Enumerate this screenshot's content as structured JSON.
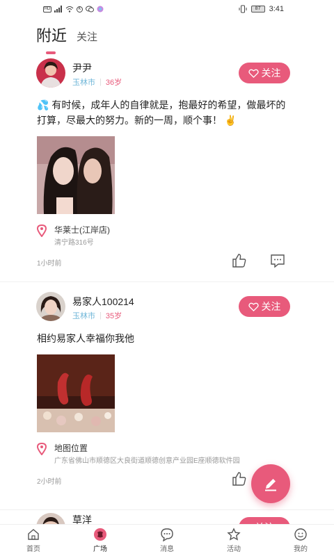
{
  "status_bar": {
    "left_icons": [
      "hd-icon",
      "signal-icon",
      "wifi-icon",
      "k-app-icon",
      "wechat-icon",
      "app-icon"
    ],
    "battery": "87",
    "time": "3:41"
  },
  "tabs": [
    {
      "label": "附近",
      "active": true
    },
    {
      "label": "关注",
      "active": false
    }
  ],
  "accent_color": "#e85a7b",
  "posts": [
    {
      "name": "尹尹",
      "city": "玉林市",
      "age": "36岁",
      "follow_label": "关注",
      "content": "💦 有时候，成年人的自律就是，抱最好的希望，做最坏的打算，尽最大的努力。新的一周，顺个事！ ✌️",
      "location_name": "华莱士(江岸店)",
      "location_addr": "清宁路316号",
      "time": "1小时前"
    },
    {
      "name": "易家人100214",
      "city": "玉林市",
      "age": "35岁",
      "follow_label": "关注",
      "content": "相约易家人幸福你我他",
      "location_name": "地图位置",
      "location_addr": "广东省佛山市顺德区大良街道顺德创意产业园E座顺德软件园",
      "time": "2小时前"
    },
    {
      "name": "草洋",
      "follow_label": "关注"
    }
  ],
  "bottom_nav": [
    {
      "label": "首页",
      "icon": "home-icon"
    },
    {
      "label": "广场",
      "icon": "plaza-icon",
      "active": true
    },
    {
      "label": "消息",
      "icon": "message-icon"
    },
    {
      "label": "活动",
      "icon": "star-icon"
    },
    {
      "label": "我的",
      "icon": "profile-icon"
    }
  ]
}
